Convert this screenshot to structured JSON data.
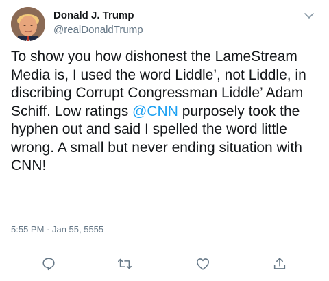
{
  "author": {
    "display_name": "Donald J. Trump",
    "handle": "@realDonaldTrump"
  },
  "tweet": {
    "text_before_mention": "To show you how dishonest the LameStream Media is, I used the word Liddle’, not Liddle, in discribing Corrupt Congressman Liddle’ Adam Schiff. Low ratings ",
    "mention": "@CNN",
    "text_after_mention": " purposely took the hyphen out and said I spelled the word little wrong. A small but never ending situation with CNN!",
    "timestamp": "5:55 PM · Jan 55, 5555"
  },
  "actions": {
    "reply_icon": "reply-icon",
    "retweet_icon": "retweet-icon",
    "like_icon": "heart-icon",
    "share_icon": "share-icon"
  },
  "colors": {
    "text": "#14171a",
    "secondary": "#657786",
    "link": "#1da1f2",
    "divider": "#e1e8ed"
  }
}
